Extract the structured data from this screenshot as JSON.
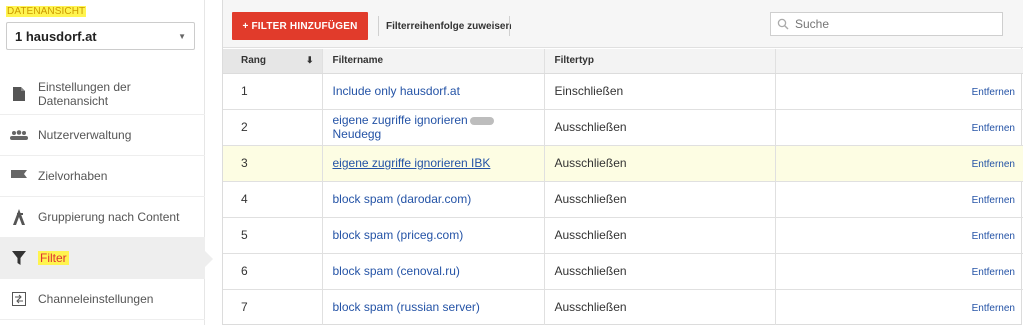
{
  "sidebar": {
    "section_label": "DATENANSICHT",
    "selected_view": "1 hausdorf.at",
    "items": [
      {
        "label": "Einstellungen der Datenansicht",
        "icon": "document-icon"
      },
      {
        "label": "Nutzerverwaltung",
        "icon": "users-icon"
      },
      {
        "label": "Zielvorhaben",
        "icon": "flag-icon"
      },
      {
        "label": "Gruppierung nach Content",
        "icon": "person-walk-icon"
      },
      {
        "label": "Filter",
        "icon": "funnel-icon",
        "active": true
      },
      {
        "label": "Channeleinstellungen",
        "icon": "channel-settings-icon"
      }
    ]
  },
  "toolbar": {
    "add_filter_label": "+ FILTER HINZUFÜGEN",
    "assign_order_label": "Filterreihenfolge zuweisen",
    "search_placeholder": "Suche"
  },
  "table": {
    "headers": {
      "rank": "Rang",
      "name": "Filtername",
      "type": "Filtertyp"
    },
    "rows": [
      {
        "rank": "1",
        "name": "Include only hausdorf.at",
        "type": "Einschließen",
        "action": "Entfernen"
      },
      {
        "rank": "2",
        "name": "eigene zugriffe ignorieren",
        "name_line2": "Neudegg",
        "type": "Ausschließen",
        "action": "Entfernen"
      },
      {
        "rank": "3",
        "name": "eigene zugriffe ignorieren IBK",
        "type": "Ausschließen",
        "action": "Entfernen"
      },
      {
        "rank": "4",
        "name": "block spam (darodar.com)",
        "type": "Ausschließen",
        "action": "Entfernen"
      },
      {
        "rank": "5",
        "name": "block spam (priceg.com)",
        "type": "Ausschließen",
        "action": "Entfernen"
      },
      {
        "rank": "6",
        "name": "block spam (cenoval.ru)",
        "type": "Ausschließen",
        "action": "Entfernen"
      },
      {
        "rank": "7",
        "name": "block spam (russian server)",
        "type": "Ausschließen",
        "action": "Entfernen"
      }
    ]
  },
  "colors": {
    "accent_red": "#e13b2b",
    "link_blue": "#2453a6",
    "highlight_yellow": "#fff44f"
  }
}
